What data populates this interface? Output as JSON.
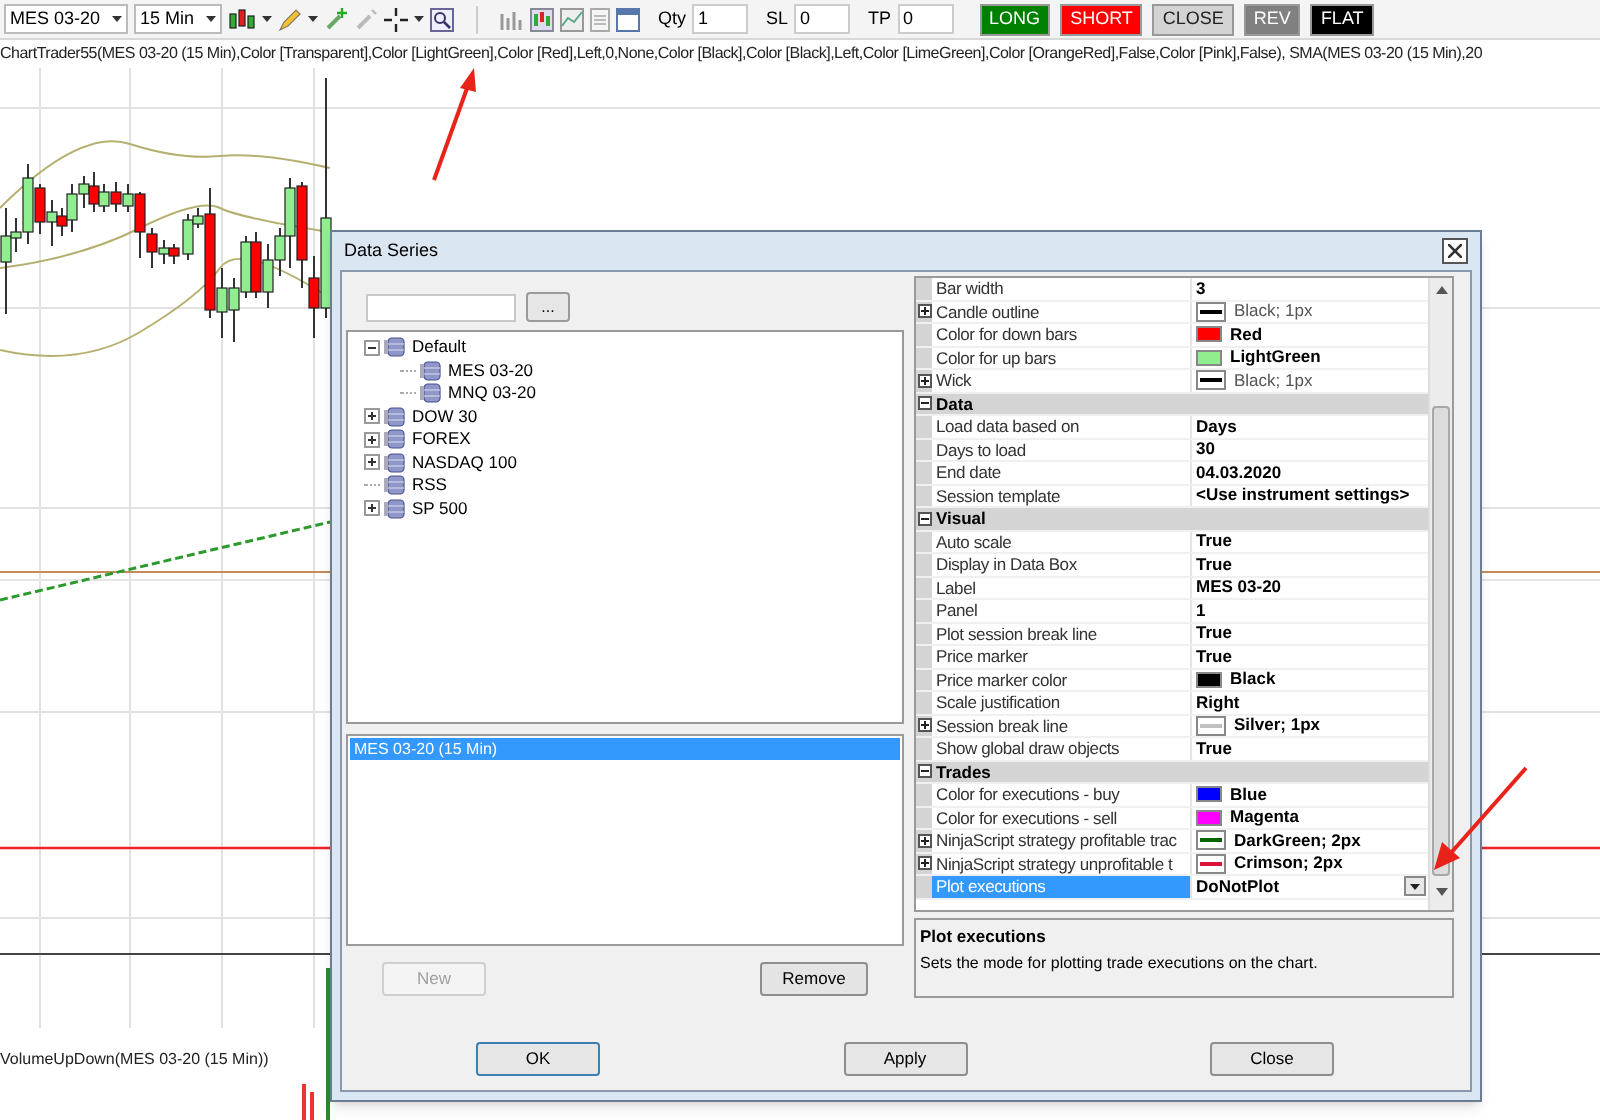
{
  "toolbar": {
    "instrument": "MES 03-20",
    "interval": "15 Min",
    "qty_label": "Qty",
    "qty": "1",
    "sl_label": "SL",
    "sl": "0",
    "tp_label": "TP",
    "tp": "0",
    "buttons": [
      {
        "label": "LONG",
        "color": "#008000"
      },
      {
        "label": "SHORT",
        "color": "#ff0000"
      },
      {
        "label": "CLOSE",
        "color": "#d3d3d3"
      },
      {
        "label": "REV",
        "color": "#808080"
      },
      {
        "label": "FLAT",
        "color": "#000000"
      }
    ]
  },
  "chart": {
    "indicator_label": "ChartTrader55(MES 03-20 (15 Min),Color [Transparent],Color [LightGreen],Color [Red],Left,0,None,Color [Black],Color [Black],Left,Color [LimeGreen],Color [OrangeRed],False,Color [Pink],False), SMA(MES 03-20 (15 Min),20",
    "volume_label": "VolumeUpDown(MES 03-20 (15 Min))"
  },
  "dialog": {
    "title": "Data Series",
    "browse_button": "...",
    "tree": [
      {
        "label": "Default",
        "expanded": true,
        "children": [
          {
            "label": "MES 03-20"
          },
          {
            "label": "MNQ 03-20"
          }
        ]
      },
      {
        "label": "DOW 30",
        "expanded": false
      },
      {
        "label": "FOREX",
        "expanded": false
      },
      {
        "label": "NASDAQ 100",
        "expanded": false
      },
      {
        "label": "RSS"
      },
      {
        "label": "SP 500",
        "expanded": false
      }
    ],
    "series_list": [
      {
        "label": "MES 03-20 (15 Min)",
        "selected": true
      }
    ],
    "new_button": {
      "label": "New",
      "disabled": true
    },
    "remove_button": {
      "label": "Remove",
      "disabled": false
    },
    "properties": [
      {
        "kind": "property",
        "label": "Bar width",
        "value": "3",
        "modified": true,
        "selected": false
      },
      {
        "kind": "stroke",
        "label": "Candle outline",
        "value": "Black; 1px",
        "modified": false,
        "expanded": false,
        "color": "#000000",
        "selected": false
      },
      {
        "kind": "color",
        "label": "Color for down bars",
        "value": "Red",
        "modified": true,
        "color": "#ff0000",
        "selected": false
      },
      {
        "kind": "color",
        "label": "Color for up bars",
        "value": "LightGreen",
        "modified": true,
        "color": "#90ee90",
        "selected": false
      },
      {
        "kind": "stroke",
        "label": "Wick",
        "value": "Black; 1px",
        "modified": false,
        "expanded": false,
        "color": "#000000",
        "selected": false
      },
      {
        "kind": "category",
        "label": "Data",
        "expanded": true
      },
      {
        "kind": "property",
        "label": "Load data based on",
        "value": "Days",
        "modified": true,
        "selected": false
      },
      {
        "kind": "property",
        "label": "Days to load",
        "value": "30",
        "modified": true,
        "selected": false
      },
      {
        "kind": "property",
        "label": "End date",
        "value": "04.03.2020",
        "modified": true,
        "selected": false
      },
      {
        "kind": "property",
        "label": "Session template",
        "value": "<Use instrument settings>",
        "modified": true,
        "selected": false
      },
      {
        "kind": "category",
        "label": "Visual",
        "expanded": true
      },
      {
        "kind": "property",
        "label": "Auto scale",
        "value": "True",
        "modified": true,
        "selected": false
      },
      {
        "kind": "property",
        "label": "Display in Data Box",
        "value": "True",
        "modified": true,
        "selected": false
      },
      {
        "kind": "property",
        "label": "Label",
        "value": "MES 03-20",
        "modified": true,
        "selected": false
      },
      {
        "kind": "property",
        "label": "Panel",
        "value": "1",
        "modified": true,
        "selected": false
      },
      {
        "kind": "property",
        "label": "Plot session break line",
        "value": "True",
        "modified": true,
        "selected": false
      },
      {
        "kind": "property",
        "label": "Price marker",
        "value": "True",
        "modified": true,
        "selected": false
      },
      {
        "kind": "color",
        "label": "Price marker color",
        "value": "Black",
        "modified": true,
        "color": "#000000",
        "selected": false
      },
      {
        "kind": "property",
        "label": "Scale justification",
        "value": "Right",
        "modified": true,
        "selected": false
      },
      {
        "kind": "stroke",
        "label": "Session break line",
        "value": "Silver; 1px",
        "modified": true,
        "expanded": false,
        "color": "#c0c0c0",
        "selected": false
      },
      {
        "kind": "property",
        "label": "Show global draw objects",
        "value": "True",
        "modified": true,
        "selected": false
      },
      {
        "kind": "category",
        "label": "Trades",
        "expanded": true
      },
      {
        "kind": "color",
        "label": "Color for executions - buy",
        "value": "Blue",
        "modified": true,
        "color": "#0000ff",
        "selected": false
      },
      {
        "kind": "color",
        "label": "Color for executions - sell",
        "value": "Magenta",
        "modified": true,
        "color": "#ff00ff",
        "selected": false
      },
      {
        "kind": "dotted",
        "label": "NinjaScript strategy profitable trac",
        "value": "DarkGreen; 2px",
        "modified": true,
        "expanded": false,
        "color": "#006400",
        "selected": false
      },
      {
        "kind": "dotted",
        "label": "NinjaScript strategy unprofitable t",
        "value": "Crimson; 2px",
        "modified": true,
        "expanded": false,
        "color": "#dc143c",
        "selected": false
      },
      {
        "kind": "property",
        "label": "Plot executions",
        "value": "DoNotPlot",
        "modified": true,
        "selected": true
      }
    ],
    "description": {
      "title": "Plot executions",
      "text": "Sets the mode for plotting trade executions on the chart."
    },
    "buttons": [
      "OK",
      "Apply",
      "Close"
    ]
  }
}
